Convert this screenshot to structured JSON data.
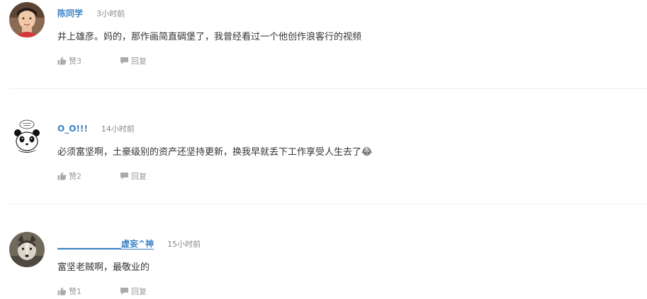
{
  "comments": [
    {
      "username": "陈同学",
      "time": "3小时前",
      "text": "井上雄彦。妈的，那作画简直碉堡了，我曾经看过一个他创作浪客行的视频",
      "like_label": "赞3",
      "reply_label": "回复",
      "avatar_icon": "person-photo-avatar"
    },
    {
      "username": "O_O!!!",
      "time": "14小时前",
      "text": "必须富坚啊，土豪级别的资产还坚持更新，换我早就丢下工作享受人生去了😂",
      "like_label": "赞2",
      "reply_label": "回复",
      "avatar_icon": "panda-avatar"
    },
    {
      "username": "_______________虚妄^神",
      "time": "15小时前",
      "text": "富坚老贼啊，最敬业的",
      "like_label": "赞1",
      "reply_label": "回复",
      "avatar_icon": "dog-photo-avatar"
    }
  ],
  "colors": {
    "username": "#3a82c4",
    "secondary_text": "#888888",
    "body_text": "#333333",
    "divider": "#eeeeee"
  },
  "icons": {
    "like": "thumbs-up-icon",
    "reply": "speech-bubble-icon"
  }
}
